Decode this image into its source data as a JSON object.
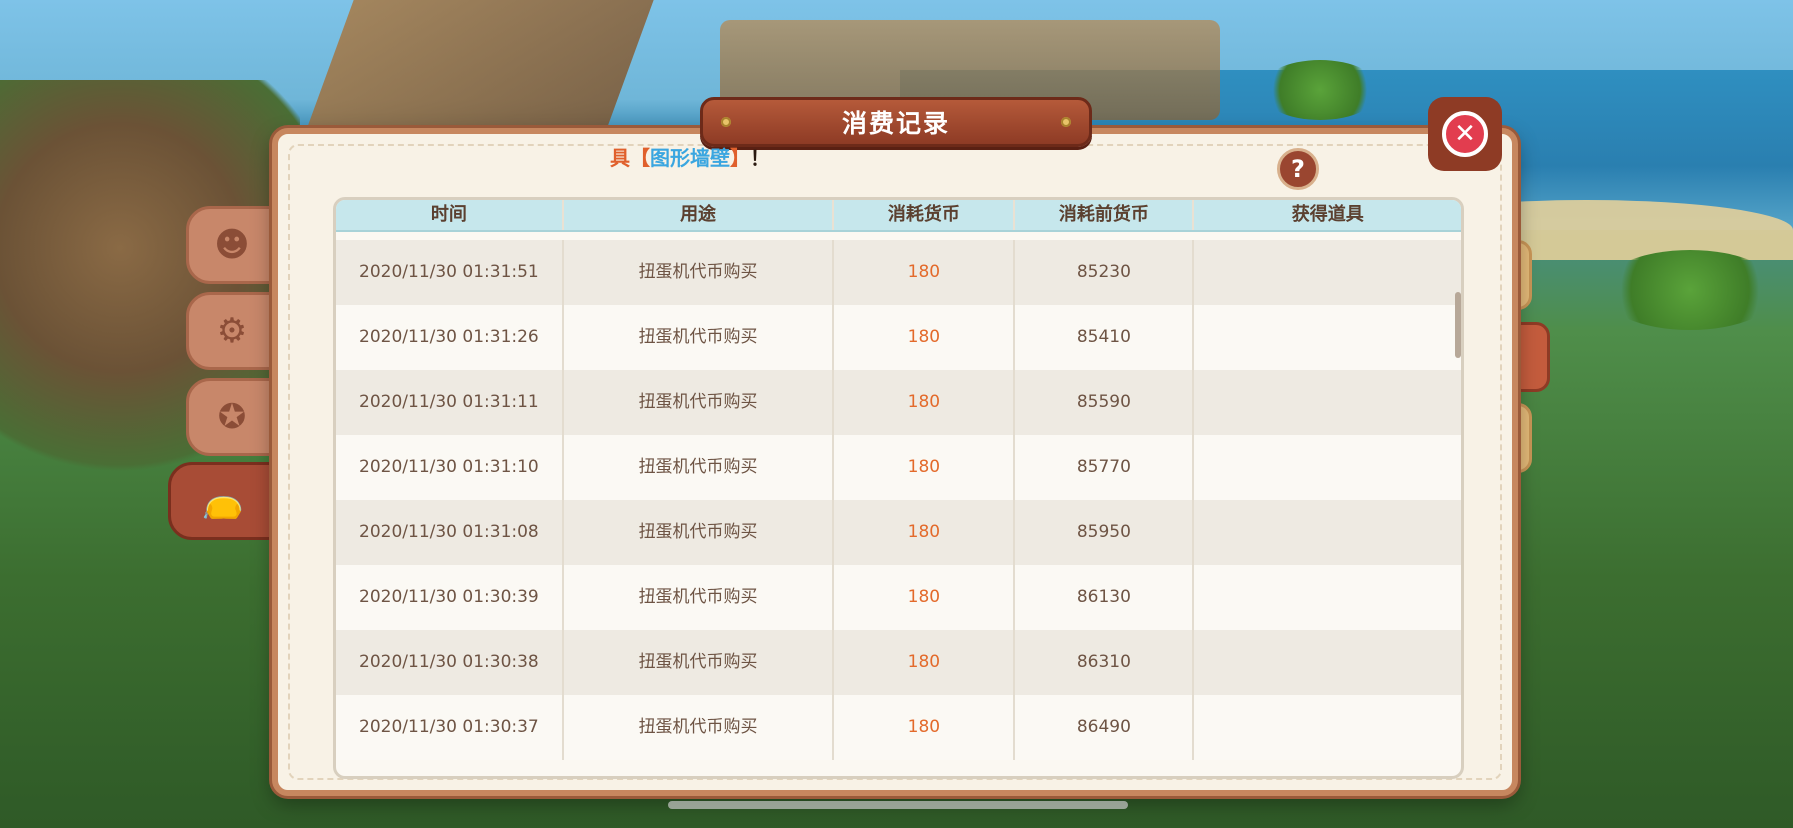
{
  "window": {
    "title": "消费记录",
    "close_icon": "close-icon",
    "help_label": "?"
  },
  "marquee": {
    "prefix": "具",
    "bracket_open": "【",
    "highlight": "图形墙壁",
    "bracket_close": "】",
    "suffix": "！"
  },
  "table": {
    "headers": [
      "时间",
      "用途",
      "消耗货币",
      "消耗前货币",
      "获得道具"
    ],
    "rows": [
      {
        "time": "2020/11/30 01:31:51",
        "purpose": "扭蛋机代币购买",
        "cost": "180",
        "before": "85230",
        "item": ""
      },
      {
        "time": "2020/11/30 01:31:26",
        "purpose": "扭蛋机代币购买",
        "cost": "180",
        "before": "85410",
        "item": ""
      },
      {
        "time": "2020/11/30 01:31:11",
        "purpose": "扭蛋机代币购买",
        "cost": "180",
        "before": "85590",
        "item": ""
      },
      {
        "time": "2020/11/30 01:31:10",
        "purpose": "扭蛋机代币购买",
        "cost": "180",
        "before": "85770",
        "item": ""
      },
      {
        "time": "2020/11/30 01:31:08",
        "purpose": "扭蛋机代币购买",
        "cost": "180",
        "before": "85950",
        "item": ""
      },
      {
        "time": "2020/11/30 01:30:39",
        "purpose": "扭蛋机代币购买",
        "cost": "180",
        "before": "86130",
        "item": ""
      },
      {
        "time": "2020/11/30 01:30:38",
        "purpose": "扭蛋机代币购买",
        "cost": "180",
        "before": "86310",
        "item": ""
      },
      {
        "time": "2020/11/30 01:30:37",
        "purpose": "扭蛋机代币购买",
        "cost": "180",
        "before": "86490",
        "item": ""
      }
    ]
  },
  "left_tabs": [
    {
      "icon": "character-icon",
      "glyph": "☻",
      "active": false
    },
    {
      "icon": "gear-icon",
      "glyph": "⚙",
      "active": false
    },
    {
      "icon": "badge-icon",
      "glyph": "✪",
      "active": false
    },
    {
      "icon": "bag-icon",
      "glyph": "👝",
      "active": true
    }
  ],
  "right_tabs": [
    {
      "icon": "coins-icon",
      "glyph": "◎",
      "active": false
    },
    {
      "icon": "gacha-icon",
      "glyph": "◉",
      "active": true
    },
    {
      "icon": "ticket-icon",
      "glyph": "◆",
      "active": false
    }
  ],
  "colors": {
    "panel_border": "#c7875f",
    "banner": "#8e3b25",
    "header_bg": "#c6e7ec",
    "cost_text": "#e36a2b"
  }
}
